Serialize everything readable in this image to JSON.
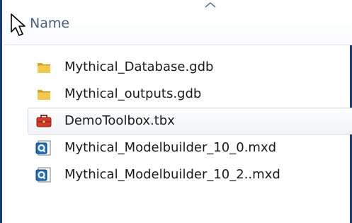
{
  "header": {
    "column_label": "Name",
    "cursor_icon": "mouse-pointer-icon",
    "sort_icon": "sort-ascending-icon"
  },
  "files": [
    {
      "name": "Mythical_Database.gdb",
      "icon": "folder-icon",
      "selected": false
    },
    {
      "name": "Mythical_outputs.gdb",
      "icon": "folder-icon",
      "selected": false
    },
    {
      "name": "DemoToolbox.tbx",
      "icon": "toolbox-icon",
      "selected": true
    },
    {
      "name": "Mythical_Modelbuilder_10_0.mxd",
      "icon": "arcmap-document-icon",
      "selected": false
    },
    {
      "name": "Mythical_Modelbuilder_10_2..mxd",
      "icon": "arcmap-document-icon",
      "selected": false
    }
  ],
  "colors": {
    "frame_border": "#1c3a6e",
    "header_text": "#4c607a",
    "selection_border": "#d2d7df",
    "folder": "#e8b83a",
    "toolbox": "#d23b2c",
    "mxd_icon": "#1f6fb8"
  }
}
